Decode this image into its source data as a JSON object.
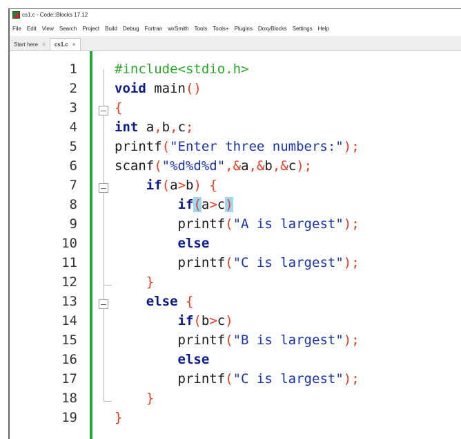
{
  "window": {
    "title": "cs1.c - Code::Blocks 17.12"
  },
  "menubar": {
    "items": [
      "File",
      "Edit",
      "View",
      "Search",
      "Project",
      "Build",
      "Debug",
      "Fortran",
      "wxSmith",
      "Tools",
      "Tools+",
      "Plugins",
      "DoxyBlocks",
      "Settings",
      "Help"
    ]
  },
  "tabs": [
    {
      "label": "Start here",
      "close": "×",
      "active": false
    },
    {
      "label": "cs1.c",
      "close": "×",
      "active": true
    }
  ],
  "colors": {
    "preprocessor": "#2aa52a",
    "keyword": "#0a1a8a",
    "operator": "#e03c1e",
    "string": "#1a33a8",
    "brace_highlight": "#9fd7f0",
    "changebar": "#1faa3c"
  },
  "editor": {
    "lines": [
      {
        "num": "1",
        "tokens": [
          {
            "t": "#include<stdio.h>",
            "k": "pp"
          }
        ]
      },
      {
        "num": "2",
        "tokens": [
          {
            "t": "void",
            "k": "kw"
          },
          {
            "t": " main",
            "k": "id"
          },
          {
            "t": "()",
            "k": "op"
          }
        ]
      },
      {
        "num": "3",
        "tokens": [
          {
            "t": "{",
            "k": "op"
          }
        ]
      },
      {
        "num": "4",
        "tokens": [
          {
            "t": "int",
            "k": "kw"
          },
          {
            "t": " a",
            "k": "id"
          },
          {
            "t": ",",
            "k": "op"
          },
          {
            "t": "b",
            "k": "id"
          },
          {
            "t": ",",
            "k": "op"
          },
          {
            "t": "c",
            "k": "id"
          },
          {
            "t": ";",
            "k": "op"
          }
        ]
      },
      {
        "num": "5",
        "tokens": [
          {
            "t": "printf",
            "k": "id"
          },
          {
            "t": "(",
            "k": "op"
          },
          {
            "t": "\"Enter three numbers:\"",
            "k": "str"
          },
          {
            "t": ");",
            "k": "op"
          }
        ]
      },
      {
        "num": "6",
        "tokens": [
          {
            "t": "scanf",
            "k": "id"
          },
          {
            "t": "(",
            "k": "op"
          },
          {
            "t": "\"%d%d%d\"",
            "k": "str"
          },
          {
            "t": ",&",
            "k": "op"
          },
          {
            "t": "a",
            "k": "id"
          },
          {
            "t": ",&",
            "k": "op"
          },
          {
            "t": "b",
            "k": "id"
          },
          {
            "t": ",&",
            "k": "op"
          },
          {
            "t": "c",
            "k": "id"
          },
          {
            "t": ");",
            "k": "op"
          }
        ]
      },
      {
        "num": "7",
        "tokens": [
          {
            "t": "    ",
            "k": "id"
          },
          {
            "t": "if",
            "k": "kw"
          },
          {
            "t": "(",
            "k": "op"
          },
          {
            "t": "a",
            "k": "id"
          },
          {
            "t": ">",
            "k": "op"
          },
          {
            "t": "b",
            "k": "id"
          },
          {
            "t": ")",
            "k": "op"
          },
          {
            "t": " {",
            "k": "op"
          }
        ]
      },
      {
        "num": "8",
        "tokens": [
          {
            "t": "        ",
            "k": "id"
          },
          {
            "t": "if",
            "k": "kw"
          },
          {
            "t": "(",
            "k": "hl"
          },
          {
            "t": "a",
            "k": "id"
          },
          {
            "t": ">",
            "k": "op"
          },
          {
            "t": "c",
            "k": "id"
          },
          {
            "t": ")",
            "k": "hl"
          }
        ]
      },
      {
        "num": "9",
        "tokens": [
          {
            "t": "        ",
            "k": "id"
          },
          {
            "t": "printf",
            "k": "id"
          },
          {
            "t": "(",
            "k": "op"
          },
          {
            "t": "\"A is largest\"",
            "k": "str"
          },
          {
            "t": ");",
            "k": "op"
          }
        ]
      },
      {
        "num": "10",
        "tokens": [
          {
            "t": "        ",
            "k": "id"
          },
          {
            "t": "else",
            "k": "kw"
          }
        ]
      },
      {
        "num": "11",
        "tokens": [
          {
            "t": "        ",
            "k": "id"
          },
          {
            "t": "printf",
            "k": "id"
          },
          {
            "t": "(",
            "k": "op"
          },
          {
            "t": "\"C is largest\"",
            "k": "str"
          },
          {
            "t": ");",
            "k": "op"
          }
        ]
      },
      {
        "num": "12",
        "tokens": [
          {
            "t": "    ",
            "k": "id"
          },
          {
            "t": "}",
            "k": "op"
          }
        ]
      },
      {
        "num": "13",
        "tokens": [
          {
            "t": "    ",
            "k": "id"
          },
          {
            "t": "else",
            "k": "kw"
          },
          {
            "t": " {",
            "k": "op"
          }
        ]
      },
      {
        "num": "14",
        "tokens": [
          {
            "t": "        ",
            "k": "id"
          },
          {
            "t": "if",
            "k": "kw"
          },
          {
            "t": "(",
            "k": "op"
          },
          {
            "t": "b",
            "k": "id"
          },
          {
            "t": ">",
            "k": "op"
          },
          {
            "t": "c",
            "k": "id"
          },
          {
            "t": ")",
            "k": "op"
          }
        ]
      },
      {
        "num": "15",
        "tokens": [
          {
            "t": "        ",
            "k": "id"
          },
          {
            "t": "printf",
            "k": "id"
          },
          {
            "t": "(",
            "k": "op"
          },
          {
            "t": "\"B is largest\"",
            "k": "str"
          },
          {
            "t": ");",
            "k": "op"
          }
        ]
      },
      {
        "num": "16",
        "tokens": [
          {
            "t": "        ",
            "k": "id"
          },
          {
            "t": "else",
            "k": "kw"
          }
        ]
      },
      {
        "num": "17",
        "tokens": [
          {
            "t": "        ",
            "k": "id"
          },
          {
            "t": "printf",
            "k": "id"
          },
          {
            "t": "(",
            "k": "op"
          },
          {
            "t": "\"C is largest\"",
            "k": "str"
          },
          {
            "t": ");",
            "k": "op"
          }
        ]
      },
      {
        "num": "18",
        "tokens": [
          {
            "t": "    ",
            "k": "id"
          },
          {
            "t": "}",
            "k": "op"
          }
        ]
      },
      {
        "num": "19",
        "tokens": [
          {
            "t": "}",
            "k": "op"
          }
        ]
      }
    ]
  }
}
